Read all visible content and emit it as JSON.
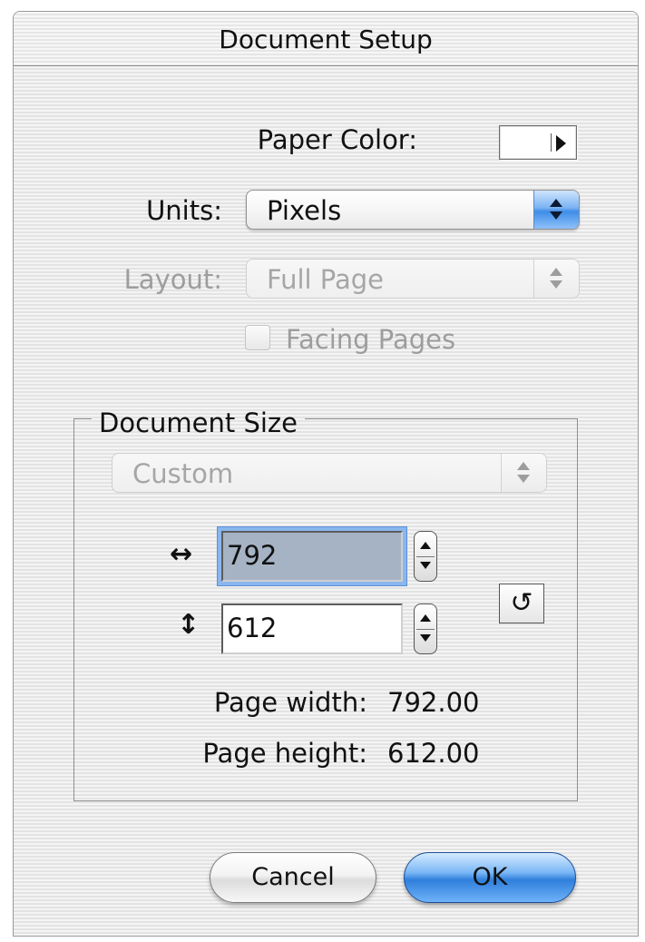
{
  "window": {
    "title": "Document Setup"
  },
  "paper_color": {
    "label": "Paper Color:",
    "value": "#ffffff"
  },
  "units": {
    "label": "Units:",
    "value": "Pixels"
  },
  "layout": {
    "label": "Layout:",
    "value": "Full Page"
  },
  "facing_pages": {
    "label": "Facing Pages",
    "checked": false
  },
  "document_size": {
    "group_title": "Document Size",
    "preset": "Custom",
    "width_value": "792",
    "height_value": "612",
    "page_width_label": "Page width:",
    "page_width_value": "792.00",
    "page_height_label": "Page height:",
    "page_height_value": "612.00",
    "width_icon": "horizontal-arrows-icon",
    "height_icon": "vertical-arrows-icon",
    "swap_icon": "swap-orientation-icon"
  },
  "buttons": {
    "cancel": "Cancel",
    "ok": "OK"
  },
  "colors": {
    "default_button": "#3a87e0",
    "focus_ring": "#8ab6ee"
  }
}
